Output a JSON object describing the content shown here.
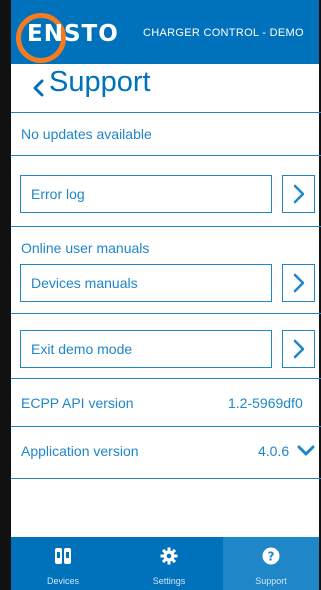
{
  "header": {
    "logo_text": "ENSTO",
    "app_title": "CHARGER CONTROL - DEMO",
    "brand_color": "#0072bc",
    "logo_ring_color": "#f47b20"
  },
  "page": {
    "back_icon": "chevron-left-icon",
    "title": "Support"
  },
  "updates": {
    "status": "No updates available"
  },
  "error_log": {
    "label": "Error log",
    "icon": "chevron-right-icon"
  },
  "manuals": {
    "heading": "Online user manuals",
    "devices_label": "Devices manuals",
    "icon": "chevron-right-icon"
  },
  "demo": {
    "exit_label": "Exit demo mode",
    "icon": "chevron-right-icon"
  },
  "api": {
    "label": "ECPP API version",
    "value": "1.2-5969df0"
  },
  "app_version": {
    "label": "Application version",
    "value": "4.0.6",
    "icon": "chevron-down-icon"
  },
  "tabs": [
    {
      "label": "Devices",
      "icon": "devices-icon",
      "active": false
    },
    {
      "label": "Settings",
      "icon": "gear-icon",
      "active": false
    },
    {
      "label": "Support",
      "icon": "help-icon",
      "active": true
    }
  ],
  "colors": {
    "accent": "#1f86c8",
    "tab_active": "#1f86c8",
    "background": "#ffffff"
  }
}
